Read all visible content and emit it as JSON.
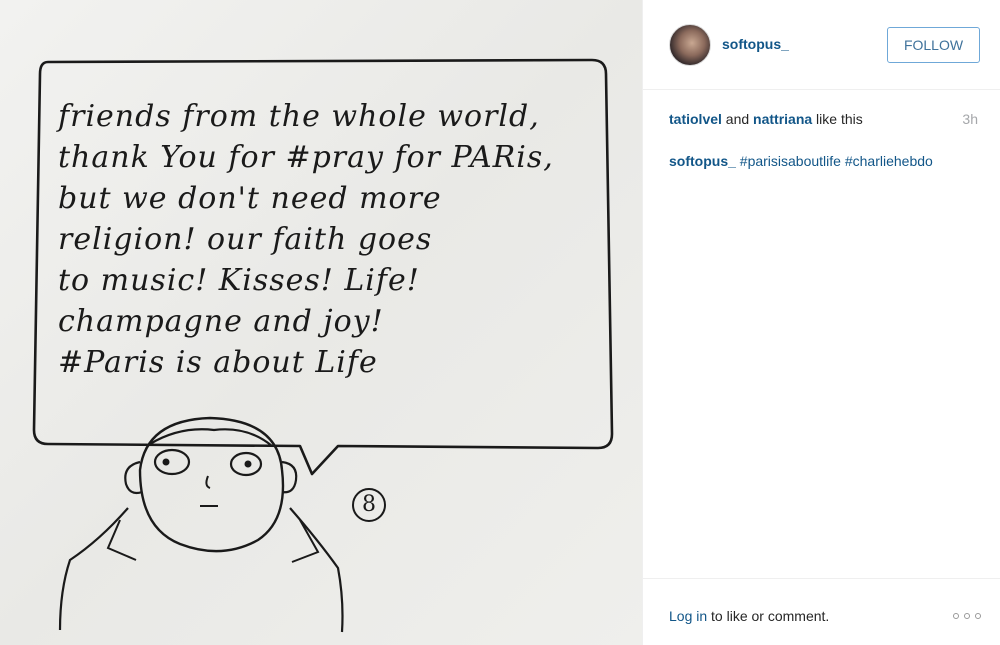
{
  "photo": {
    "handwritten_lines": [
      "friends from the whole world,",
      "thank You for #pray for PARis,",
      "but we don't need more",
      "religion! our faith goes",
      "to music! Kisses! Life!",
      "champagne and joy!",
      "#Paris is about Life"
    ],
    "signature_number": "8"
  },
  "post": {
    "author": "softopus_",
    "follow_label": "FOLLOW",
    "likes": {
      "user1": "tatiolvel",
      "connector": " and ",
      "user2": "nattriana",
      "suffix": " like this"
    },
    "timestamp": "3h",
    "caption": {
      "author": "softopus_",
      "tag1": "#parisisaboutlife",
      "tag2": "#charliehebdo"
    },
    "footer": {
      "login_link": "Log in",
      "login_suffix": " to like or comment."
    }
  },
  "icons": {
    "more": "more-options-icon",
    "avatar": "avatar"
  },
  "colors": {
    "link": "#125688",
    "follow_border": "#6fa8d8",
    "follow_text": "#3f729b",
    "muted": "#a5a7aa"
  }
}
